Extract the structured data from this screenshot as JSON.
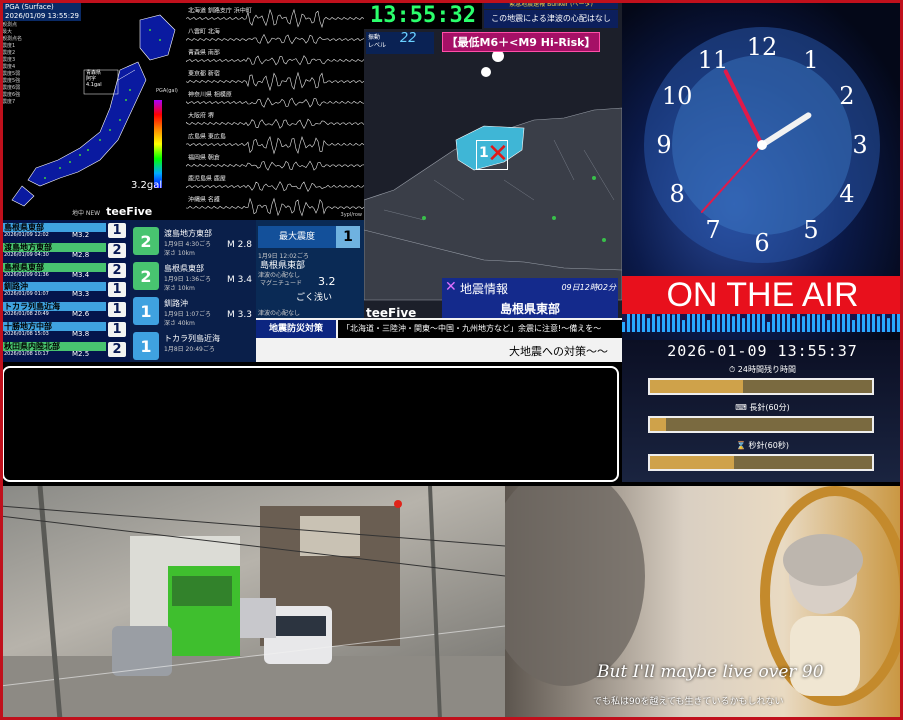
{
  "shake_map": {
    "header_line1": "PGA (Surface)",
    "header_line2": "2026/01/09 13:55:29",
    "legend": [
      "観測点",
      "最大",
      "観測点名",
      "震度1",
      "震度2",
      "震度3",
      "震度4",
      "震度5弱",
      "震度5強",
      "震度6弱",
      "震度6強",
      "震度7"
    ],
    "station_label": "青森県\n阿字\n4.1gal",
    "scale_label": "PGA(gal)",
    "gal_value": "3.2gal",
    "brand_prefix": "地中 NEW",
    "brand": "teeFive"
  },
  "seismograph": {
    "stations": [
      "北海道 釧路支庁 浜中町",
      "八雲町 北海",
      "青森県 南部",
      "東京都 新宿",
      "神奈川県 相模原",
      "大阪府 堺",
      "広島県 東広島",
      "福岡県 朝倉",
      "鹿児島県 鹿屋",
      "沖縄県 名護"
    ],
    "footer": "3ypl/row"
  },
  "map_panel": {
    "clock": "13:55:32",
    "notice_top": "緊急地震速報 Bunker (ベータ)",
    "notice": "この地震による津波の心配はなし",
    "level_label": "振動\nレベル",
    "level_value": "22",
    "risk": "【最低M6＋<M9 Hi-Risk】",
    "brand": "teeFive",
    "info_title": "地震情報",
    "info_time": "09日12時02分",
    "info_place": "島根県東部",
    "epicenter_intensity": "1"
  },
  "eq_list": [
    {
      "name": "島根県東部",
      "date": "2026/01/09 12:02",
      "mag": "M3.2",
      "int": "1",
      "color": "#3fa2e0"
    },
    {
      "name": "渡島地方東部",
      "date": "2026/01/09 04:30",
      "mag": "M2.8",
      "int": "2",
      "color": "#48c470"
    },
    {
      "name": "島根県東部",
      "date": "2026/01/09 01:36",
      "mag": "M3.4",
      "int": "2",
      "color": "#48c470"
    },
    {
      "name": "釧路沖",
      "date": "2026/01/09 01:07",
      "mag": "M3.3",
      "int": "1",
      "color": "#3fa2e0"
    },
    {
      "name": "トカラ列島近海",
      "date": "2026/01/08 20:49",
      "mag": "M2.6",
      "int": "1",
      "color": "#3fa2e0"
    },
    {
      "name": "十勝地方中部",
      "date": "2026/01/08 15:03",
      "mag": "M3.8",
      "int": "1",
      "color": "#3fa2e0"
    },
    {
      "name": "秋田県内陸北部",
      "date": "2026/01/08 10:17",
      "mag": "M2.5",
      "int": "2",
      "color": "#48c470"
    }
  ],
  "eq_detail": [
    {
      "name": "渡島地方東部",
      "date": "1月9日 4:30ごろ",
      "depth": "深さ 10km",
      "mag": "M 2.8",
      "int": "2",
      "color": "#48c470"
    },
    {
      "name": "島根県東部",
      "date": "1月9日 1:36ごろ",
      "depth": "深さ 10km",
      "mag": "M 3.4",
      "int": "2",
      "color": "#48c470"
    },
    {
      "name": "釧路沖",
      "date": "1月9日 1:07ごろ",
      "depth": "深さ 40km",
      "mag": "M 3.3",
      "int": "1",
      "color": "#3fa2e0"
    },
    {
      "name": "トカラ列島近海",
      "date": "1月8日 20:49ごろ",
      "depth": "",
      "mag": "",
      "int": "1",
      "color": "#3fa2e0"
    }
  ],
  "max_intensity": {
    "label": "最大震度",
    "value": "1",
    "time": "1月9日 12:02ごろ",
    "place": "島根県東部",
    "tsunami": "津波の心配なし",
    "mag_label": "マグニチュード",
    "mag_value": "3.2",
    "depth": "ごく浅い",
    "tsunami2": "津波の心配なし"
  },
  "banner": {
    "tag": "地震防災対策",
    "message": "「北海道・三陸沖・関東〜中国・九州地方など」余震に注意!〜備えを〜",
    "sub": "大地震への対策〜〜"
  },
  "clock_panel": {
    "on_air": "ON THE AIR",
    "numbers": [
      "12",
      "1",
      "2",
      "3",
      "4",
      "5",
      "6",
      "7",
      "8",
      "9",
      "10",
      "11"
    ]
  },
  "timer": {
    "datetime": "2026-01-09 13:55:37",
    "label_24h": "24時間残り時間",
    "label_long": "長針(60分)",
    "label_second": "秒針(60秒)",
    "progress_24h": 0.42,
    "progress_long": 0.07,
    "progress_second": 0.38
  },
  "camera": {
    "label": "street-camera"
  },
  "mv": {
    "caption": "But I'll maybe live over 90",
    "subtitle": "でも私は90を越えても生きているかもしれない"
  }
}
